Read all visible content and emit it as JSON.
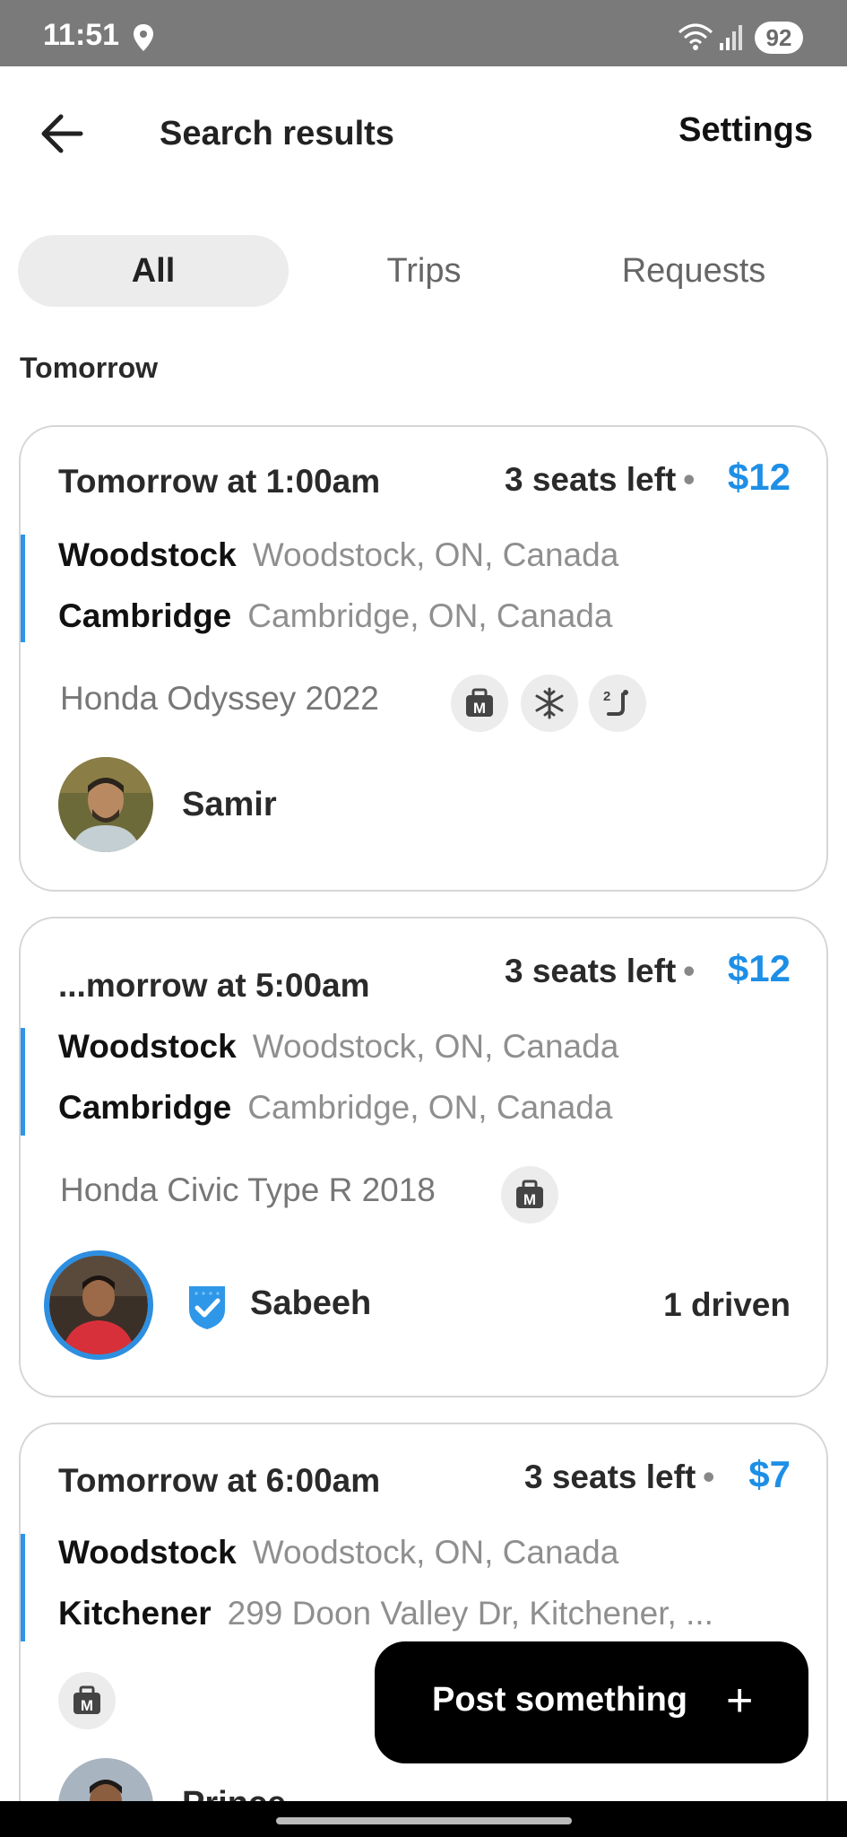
{
  "status_bar": {
    "time": "11:51",
    "battery": "92"
  },
  "header": {
    "title": "Search results",
    "settings_label": "Settings"
  },
  "tabs": [
    {
      "label": "All",
      "active": true
    },
    {
      "label": "Trips",
      "active": false
    },
    {
      "label": "Requests",
      "active": false
    }
  ],
  "section_label": "Tomorrow",
  "trips": [
    {
      "time": "Tomorrow at 1:00am",
      "seats": "3 seats left",
      "price": "$12",
      "from_city": "Woodstock",
      "from_address": "Woodstock, ON, Canada",
      "to_city": "Cambridge",
      "to_address": "Cambridge, ON, Canada",
      "car": "Honda Odyssey 2022",
      "amenities": [
        "luggage-icon",
        "snowflake-icon",
        "two-back-seat-icon"
      ],
      "driver": "Samir"
    },
    {
      "time": "...morrow at 5:00am",
      "seats": "3 seats left",
      "price": "$12",
      "from_city": "Woodstock",
      "from_address": "Woodstock, ON, Canada",
      "to_city": "Cambridge",
      "to_address": "Cambridge, ON, Canada",
      "car": "Honda Civic Type R 2018",
      "amenities": [
        "luggage-icon"
      ],
      "driver": "Sabeeh",
      "driven": "1 driven",
      "verified": true
    },
    {
      "time": "Tomorrow at 6:00am",
      "seats": "3 seats left",
      "price": "$7",
      "from_city": "Woodstock",
      "from_address": "Woodstock, ON, Canada",
      "to_city": "Kitchener",
      "to_address": "299 Doon Valley Dr, Kitchener, ...",
      "amenities": [
        "luggage-icon"
      ],
      "driver": "Prince"
    }
  ],
  "fab": {
    "label": "Post something",
    "icon": "plus-icon"
  },
  "colors": {
    "accent": "#1e8fe6",
    "route_bar": "#2e95e8",
    "status_bar": "#7a7a7a"
  }
}
